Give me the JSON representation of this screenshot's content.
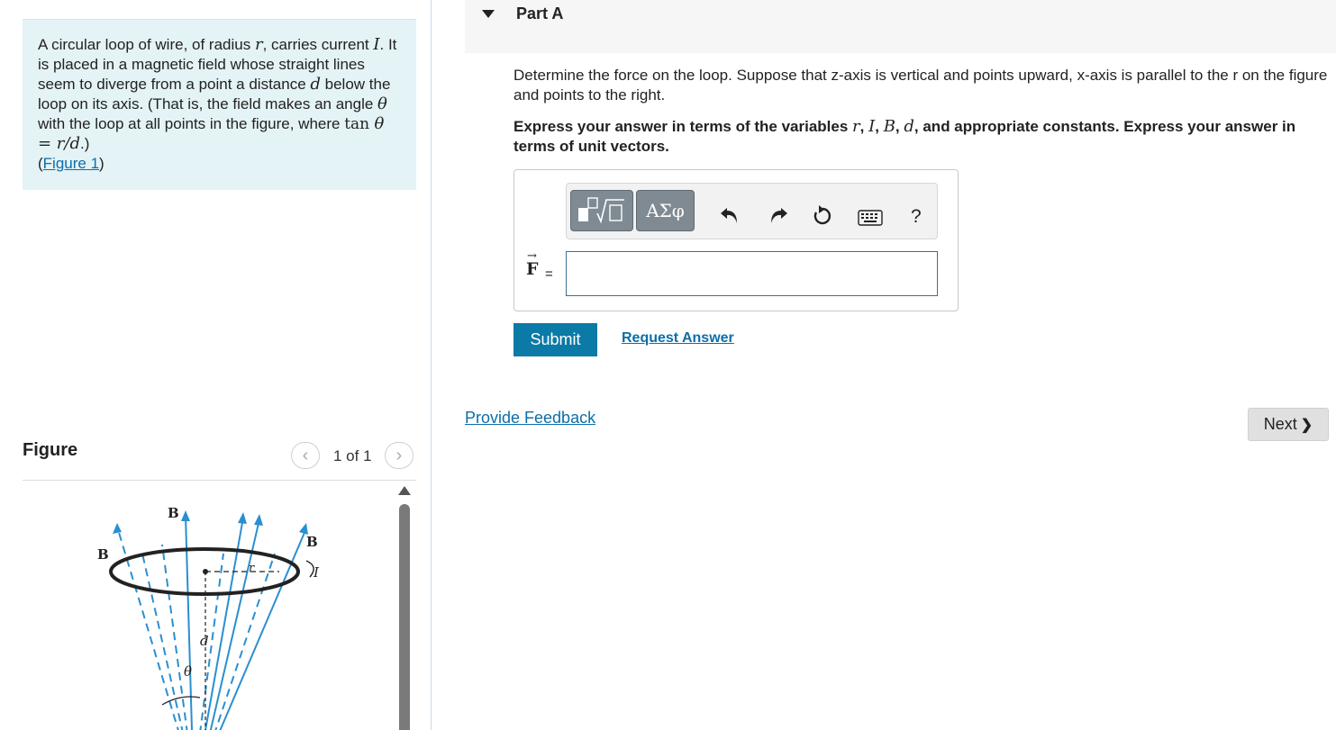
{
  "problem": {
    "t1": "A circular loop of wire, of radius ",
    "var_r": "r",
    "t2": ", carries current ",
    "var_I": "I",
    "t3": ". It is placed in a magnetic field whose straight lines seem to diverge from a point a distance ",
    "var_d": "d",
    "t4": " below the loop on its axis. (That is, the field makes an angle ",
    "var_theta": "θ",
    "t5": " with the loop at all points in the figure, where ",
    "tan_fn": "tan ",
    "eq_expr": "θ = r/d",
    "t6": ".)",
    "link_open": "(",
    "link_text": "Figure 1",
    "link_close": ")"
  },
  "figure": {
    "heading": "Figure",
    "pager_text": "1 of 1",
    "prev_glyph": "‹",
    "next_glyph": "›",
    "labels": {
      "B_top": "B",
      "B_left": "B",
      "B_right": "B",
      "I": "I",
      "r": "r",
      "d": "d",
      "theta": "θ"
    }
  },
  "part": {
    "title": "Part A"
  },
  "question": {
    "text": "Determine the force on the loop. Suppose that z-axis is vertical and points upward, x-axis is parallel to the r on the figure and points to the right."
  },
  "instructions": {
    "t1": "Express your answer in terms of the variables ",
    "v1": "r",
    "s1": ", ",
    "v2": "I",
    "s2": ", ",
    "v3": "B",
    "s3": ", ",
    "v4": "d",
    "t2": ", and appropriate constants. Express your answer in terms of unit vectors."
  },
  "toolbar": {
    "greek_label": "ΑΣφ",
    "help_label": "?",
    "icons": [
      "templates-icon",
      "undo-icon",
      "redo-icon",
      "reset-icon",
      "keyboard-icon",
      "help-icon"
    ]
  },
  "answer": {
    "label": "F",
    "vector_arrow": "→",
    "equals": "=",
    "value": ""
  },
  "actions": {
    "submit": "Submit",
    "request_answer": "Request Answer",
    "provide_feedback": "Provide Feedback",
    "next": "Next",
    "next_glyph": "❯"
  },
  "colors": {
    "problem_bg": "#e4f3f5",
    "link": "#0d6ea8",
    "submit_bg": "#0b7aa6",
    "field_lines": "#2a8fd0"
  }
}
